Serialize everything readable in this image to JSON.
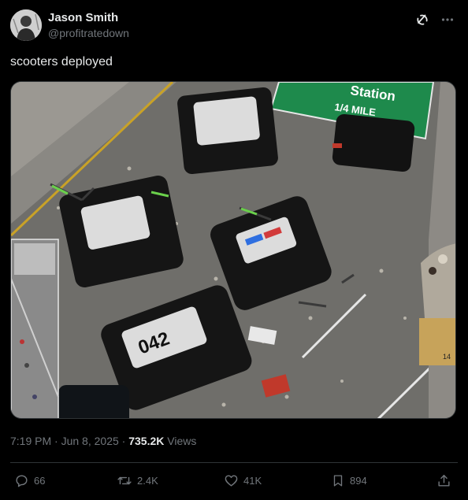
{
  "author": {
    "display_name": "Jason Smith",
    "handle": "@profitratedown"
  },
  "tweet": {
    "text": "scooters deployed"
  },
  "media": {
    "sign_line1": "Station",
    "sign_line2": "1/4 MILE",
    "car_roof_number": "042",
    "sign_number": "14"
  },
  "meta": {
    "time": "7:19 PM",
    "separator1": " · ",
    "date": "Jun 8, 2025",
    "separator2": " · ",
    "views_count": "735.2K",
    "views_label": " Views"
  },
  "actions": {
    "reply_count": "66",
    "repost_count": "2.4K",
    "like_count": "41K",
    "bookmark_count": "894"
  },
  "colors": {
    "background": "#000000",
    "text_primary": "#e7e9ea",
    "text_secondary": "#71767b",
    "divider": "#2f3336",
    "highway_sign": "#1e8a4c"
  },
  "icons": [
    "grok-icon",
    "more-icon",
    "reply-icon",
    "repost-icon",
    "like-icon",
    "bookmark-icon",
    "share-icon"
  ]
}
